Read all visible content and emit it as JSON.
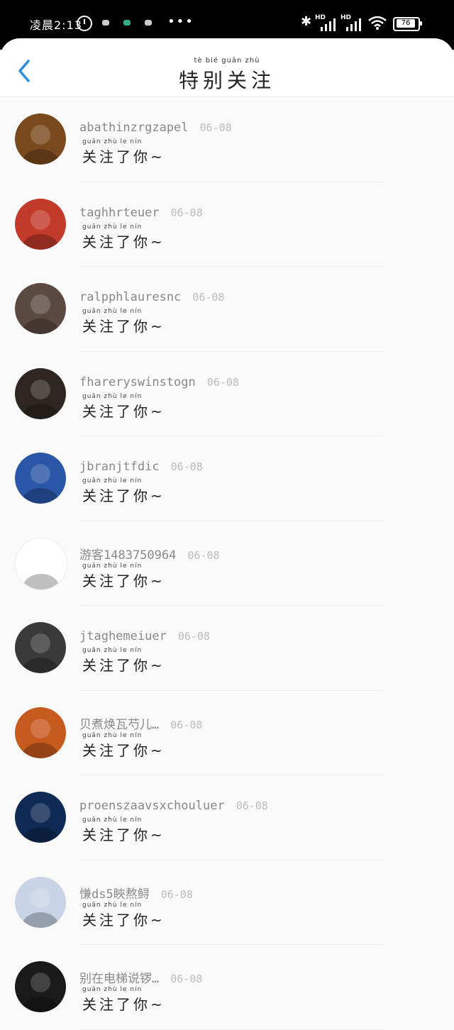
{
  "status_bar": {
    "time": "凌晨2:13",
    "battery": "76",
    "network_1": "HD",
    "network_2": "HD",
    "dots": "•••"
  },
  "header": {
    "title": "特别关注",
    "title_pinyin": "tè bié guān zhù",
    "back_icon": "chevron-left-icon"
  },
  "followers": [
    {
      "name": "abathinzrgzapel",
      "date": "06-08",
      "message": "关注了你~",
      "message_pinyin": "guān zhù le nín"
    },
    {
      "name": "taghhrteuer",
      "date": "06-08",
      "message": "关注了你~",
      "message_pinyin": "guān zhù le nín"
    },
    {
      "name": "ralpphlauresnc",
      "date": "06-08",
      "message": "关注了你~",
      "message_pinyin": "guān zhù le nín"
    },
    {
      "name": "fhareryswinstogn",
      "date": "06-08",
      "message": "关注了你~",
      "message_pinyin": "guān zhù le nín"
    },
    {
      "name": "jbranjtfdic",
      "date": "06-08",
      "message": "关注了你~",
      "message_pinyin": "guān zhù le nín"
    },
    {
      "name": "游客1483750964",
      "date": "06-08",
      "message": "关注了你~",
      "message_pinyin": "guān zhù le nín"
    },
    {
      "name": "jtaghemeiuer",
      "date": "06-08",
      "message": "关注了你~",
      "message_pinyin": "guān zhù le nín"
    },
    {
      "name": "贝煮焕瓦芍儿…",
      "date": "06-08",
      "message": "关注了你~",
      "message_pinyin": "guān zhù le nín"
    },
    {
      "name": "proenszaavsxchouluer",
      "date": "06-08",
      "message": "关注了你~",
      "message_pinyin": "guān zhù le nín"
    },
    {
      "name": "慊ds5䀹熬鲟",
      "date": "06-08",
      "message": "关注了你~",
      "message_pinyin": "guān zhù le nín"
    },
    {
      "name": "别在电梯说锣…",
      "date": "06-08",
      "message": "关注了你~",
      "message_pinyin": "guān zhù le nín"
    }
  ],
  "avatar_colors": [
    "#7a4a1e",
    "#c23a2a",
    "#5b4a42",
    "#2f2622",
    "#2a56a8",
    "#ffffff",
    "#3a3a3a",
    "#c75a1e",
    "#0f2a55",
    "#c9d4e6",
    "#1a1a1a"
  ]
}
